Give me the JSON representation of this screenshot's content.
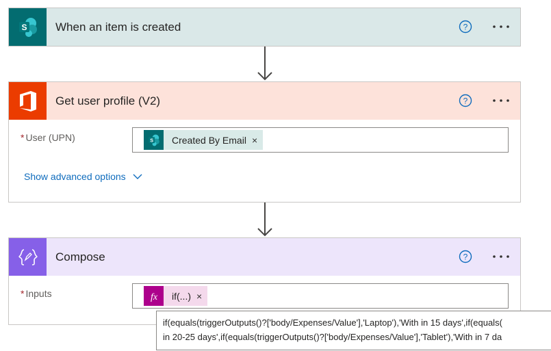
{
  "steps": {
    "trigger": {
      "title": "When an item is created",
      "color": "#dae8e8",
      "icon": "sharepoint-icon",
      "icon_color": "#036c70"
    },
    "profile": {
      "title": "Get user profile (V2)",
      "color": "#fde2da",
      "icon": "office-icon",
      "icon_color": "#eb3c00",
      "field": {
        "required_mark": "*",
        "label": "User (UPN)",
        "token": {
          "label": "Created By Email",
          "remove": "×",
          "icon": "sharepoint-icon",
          "color": "#d9eae8"
        }
      },
      "advanced_label": "Show advanced options"
    },
    "compose": {
      "title": "Compose",
      "color": "#ede5fb",
      "icon": "compose-braces-icon",
      "icon_color": "#8660e8",
      "field": {
        "required_mark": "*",
        "label": "Inputs",
        "token": {
          "label": "if(...)",
          "remove": "×",
          "icon": "fx-icon",
          "color": "#f4d9ec"
        }
      }
    }
  },
  "tooltip": {
    "line1": "if(equals(triggerOutputs()?['body/Expenses/Value'],'Laptop'),'With in 15 days',if(equals(",
    "line2": "in 20-25 days',if(equals(triggerOutputs()?['body/Expenses/Value'],'Tablet'),'With in 7 da"
  }
}
